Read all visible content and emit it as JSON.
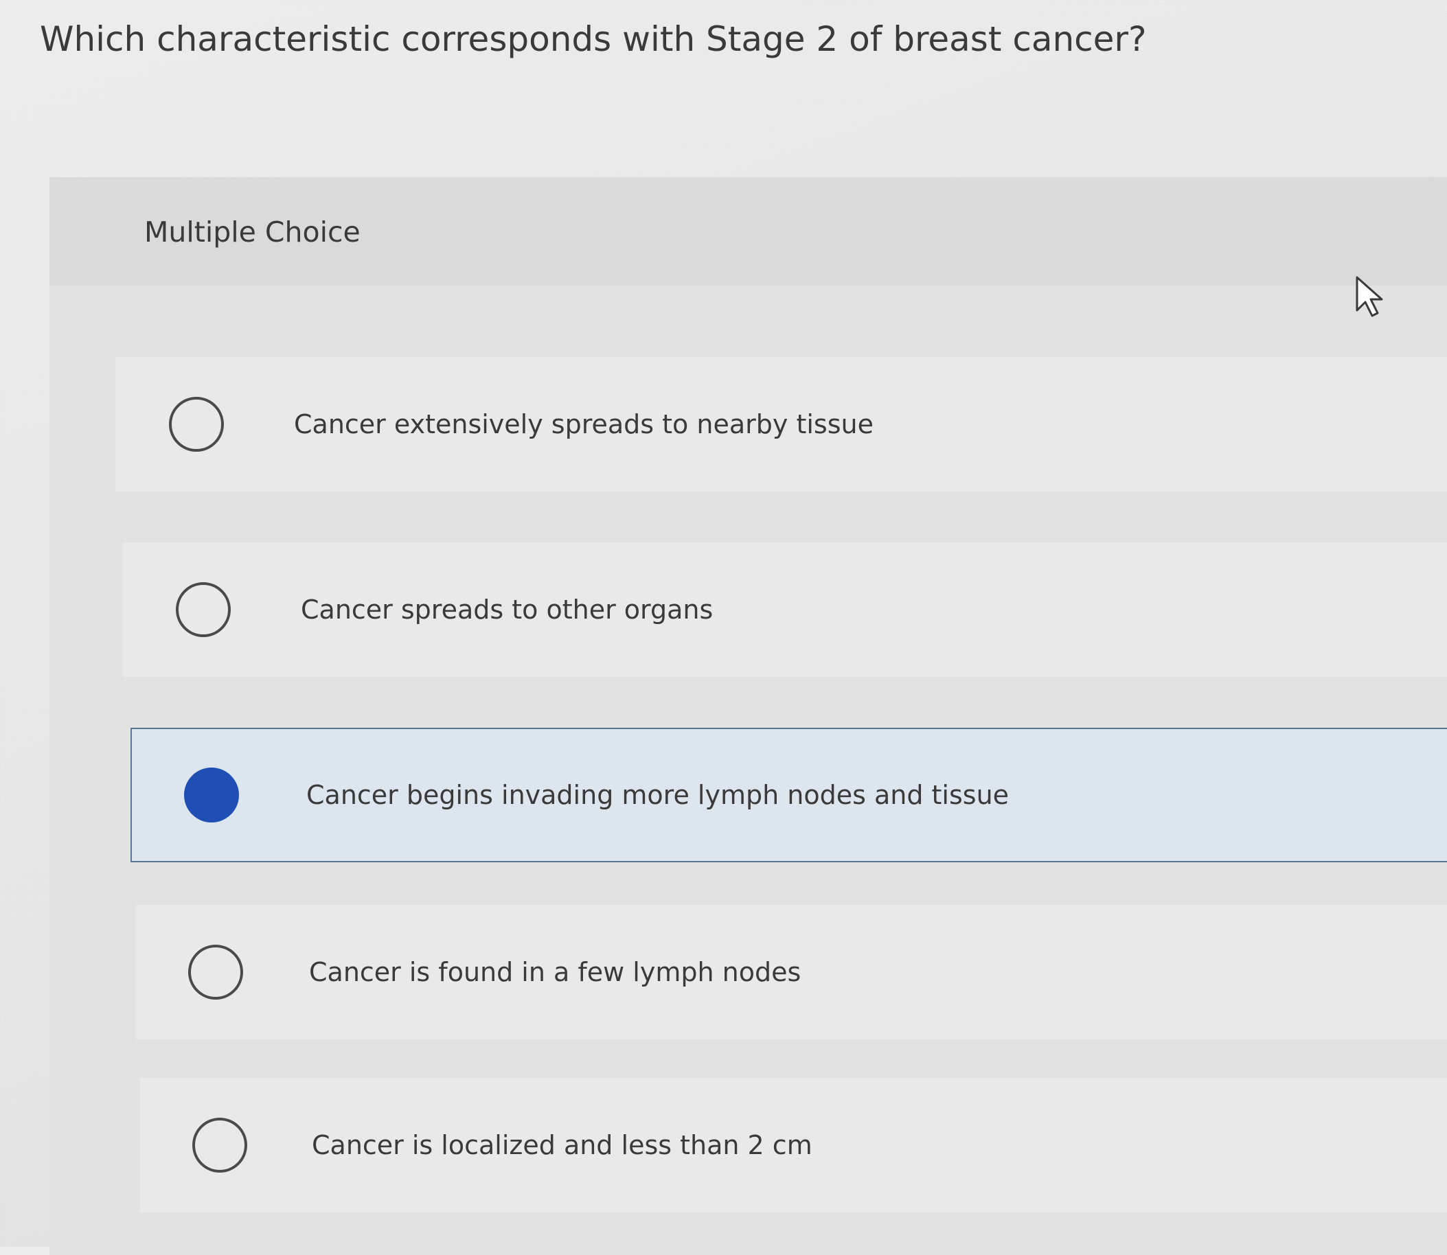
{
  "question": {
    "text": "Which characteristic corresponds with Stage 2 of breast cancer?"
  },
  "panel": {
    "label": "Multiple Choice"
  },
  "options": [
    {
      "label": "Cancer extensively spreads to nearby tissue",
      "selected": false
    },
    {
      "label": "Cancer spreads to other organs",
      "selected": false
    },
    {
      "label": "Cancer begins invading more lymph nodes and tissue",
      "selected": true
    },
    {
      "label": "Cancer is found in a few lymph nodes",
      "selected": false
    },
    {
      "label": "Cancer is localized and less than 2 cm",
      "selected": false
    }
  ],
  "colors": {
    "selected_radio": "#1f4fb4",
    "selected_border": "#5d7593",
    "selected_background": "#dde6ee"
  },
  "icons": {
    "cursor": "mouse-pointer-icon"
  }
}
